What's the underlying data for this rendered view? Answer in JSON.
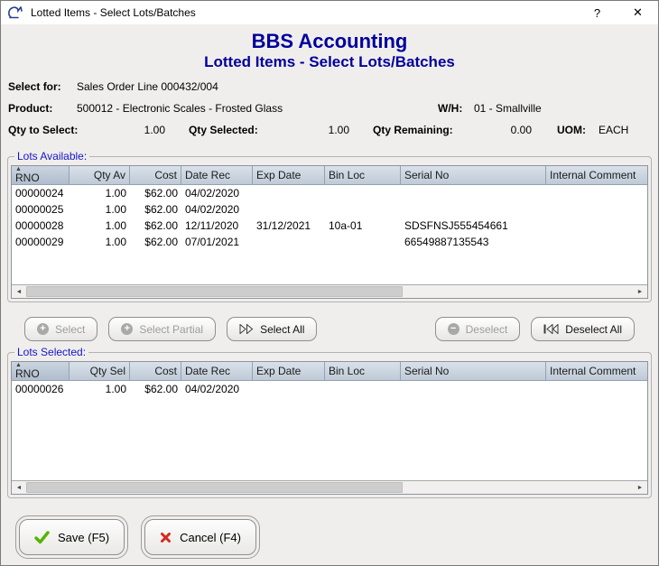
{
  "window": {
    "title": "Lotted Items - Select Lots/Batches",
    "help_label": "?",
    "close_label": "✕"
  },
  "header": {
    "app_name": "BBS Accounting",
    "subtitle": "Lotted Items - Select Lots/Batches"
  },
  "info": {
    "select_for_label": "Select for:",
    "select_for_value": "Sales Order Line 000432/004",
    "product_label": "Product:",
    "product_value": "500012 - Electronic Scales - Frosted Glass",
    "wh_label": "W/H:",
    "wh_value": "01 - Smallville",
    "qty_to_select_label": "Qty to Select:",
    "qty_to_select_value": "1.00",
    "qty_selected_label": "Qty Selected:",
    "qty_selected_value": "1.00",
    "qty_remaining_label": "Qty Remaining:",
    "qty_remaining_value": "0.00",
    "uom_label": "UOM:",
    "uom_value": "EACH"
  },
  "lots_available": {
    "group_label": "Lots Available:",
    "columns": [
      "RNO",
      "Qty Av",
      "Cost",
      "Date Rec",
      "Exp Date",
      "Bin Loc",
      "Serial No",
      "Internal Comment"
    ],
    "rows": [
      [
        "00000024",
        "1.00",
        "$62.00",
        "04/02/2020",
        "",
        "",
        "",
        ""
      ],
      [
        "00000025",
        "1.00",
        "$62.00",
        "04/02/2020",
        "",
        "",
        "",
        ""
      ],
      [
        "00000028",
        "1.00",
        "$62.00",
        "12/11/2020",
        "31/12/2021",
        "10a-01",
        "SDSFNSJ555454661",
        ""
      ],
      [
        "00000029",
        "1.00",
        "$62.00",
        "07/01/2021",
        "",
        "",
        "66549887135543",
        ""
      ]
    ]
  },
  "lots_selected": {
    "group_label": "Lots Selected:",
    "columns": [
      "RNO",
      "Qty Sel",
      "Cost",
      "Date Rec",
      "Exp Date",
      "Bin Loc",
      "Serial No",
      "Internal Comment"
    ],
    "rows": [
      [
        "00000026",
        "1.00",
        "$62.00",
        "04/02/2020",
        "",
        "",
        "",
        ""
      ]
    ]
  },
  "actions": {
    "select_label": "Select",
    "select_partial_label": "Select Partial",
    "select_all_label": "Select All",
    "deselect_label": "Deselect",
    "deselect_all_label": "Deselect All"
  },
  "footer": {
    "save_label": "Save (F5)",
    "cancel_label": "Cancel (F4)"
  },
  "icons": {
    "sort_asc": "▲",
    "scroll_left": "◄",
    "scroll_right": "►",
    "plus": "+",
    "minus": "−"
  },
  "colors": {
    "header_blue": "#00009c",
    "group_label_blue": "#1414c8",
    "table_header_fill": "#c6d1de",
    "save_check_green": "#54b400",
    "cancel_x_red": "#d42a1e"
  }
}
